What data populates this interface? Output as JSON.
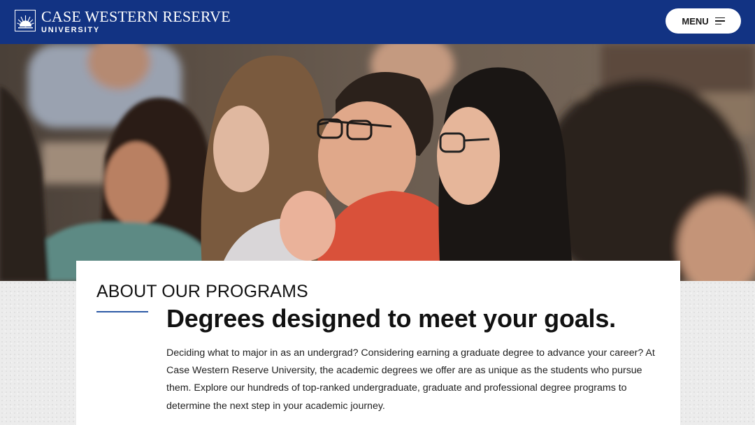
{
  "header": {
    "logo_line1": "CASE WESTERN RESERVE",
    "logo_line2": "UNIVERSITY",
    "menu_label": "MENU"
  },
  "hero": {
    "image_alt": "Students attentively listening in a lecture hall"
  },
  "content": {
    "eyebrow": "ABOUT OUR PROGRAMS",
    "headline": "Degrees designed to meet your goals.",
    "body": "Deciding what to major in as an undergrad? Considering earning a graduate degree to advance your career? At Case Western Reserve University, the academic degrees we offer are as unique as the students who pursue them. Explore our hundreds of top-ranked undergraduate, graduate and professional degree programs to determine the next step in your academic journey."
  },
  "colors": {
    "header_bg": "#123383",
    "accent_rule": "#2d5aa6",
    "card_bg": "#ffffff"
  },
  "icons": {
    "logo": "sunburst-logo-icon",
    "menu": "menu-lines-icon"
  }
}
